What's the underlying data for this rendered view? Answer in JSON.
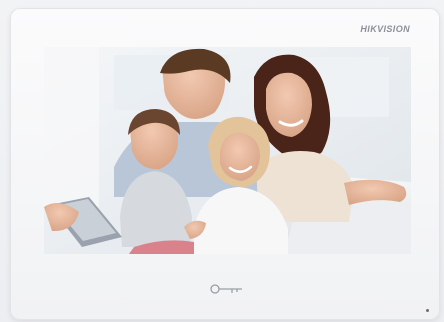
{
  "device": {
    "brand": "HIKVISION",
    "icons": {
      "unlock": "key-icon",
      "indicator": "status-led-icon"
    },
    "colors": {
      "bezel": "#f1f2f4",
      "brand_text": "#8b8f96",
      "screen_bg": "#e9eef3"
    }
  }
}
